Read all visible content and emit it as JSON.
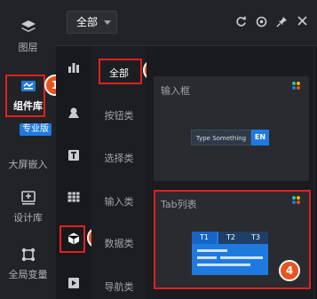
{
  "sidebar": {
    "items": [
      {
        "label": "图层",
        "icon": "layers-icon"
      },
      {
        "label": "组件库",
        "icon": "component-library-icon",
        "active": true
      },
      {
        "label": "大屏嵌入",
        "icon": "screen-embed-icon"
      },
      {
        "label": "设计库",
        "icon": "design-library-icon"
      },
      {
        "label": "全局变量",
        "icon": "global-variable-icon"
      }
    ],
    "pro_tag": "专业版"
  },
  "topbar": {
    "dropdown_value": "全部",
    "icons": [
      "refresh-icon",
      "settings-icon",
      "pin-icon",
      "close-icon"
    ]
  },
  "icon_column": [
    "chart-icon",
    "map-pin-icon",
    "text-icon",
    "table-icon",
    "cube-icon",
    "media-icon"
  ],
  "categories": [
    {
      "label": "全部",
      "active": true
    },
    {
      "label": "按钮类"
    },
    {
      "label": "选择类"
    },
    {
      "label": "输入类"
    },
    {
      "label": "数据类"
    },
    {
      "label": "导航类"
    }
  ],
  "cards": [
    {
      "title": "输入框",
      "preview_placeholder": "Type Something",
      "preview_button": "EN"
    },
    {
      "title": "Tab列表",
      "tabs": [
        "T1",
        "T2",
        "T3"
      ]
    }
  ],
  "annotations": [
    "1",
    "2",
    "3",
    "4"
  ],
  "colors": {
    "accent": "#1f7ae0",
    "annotation": "#e8541e",
    "highlight_border": "#e02020"
  }
}
